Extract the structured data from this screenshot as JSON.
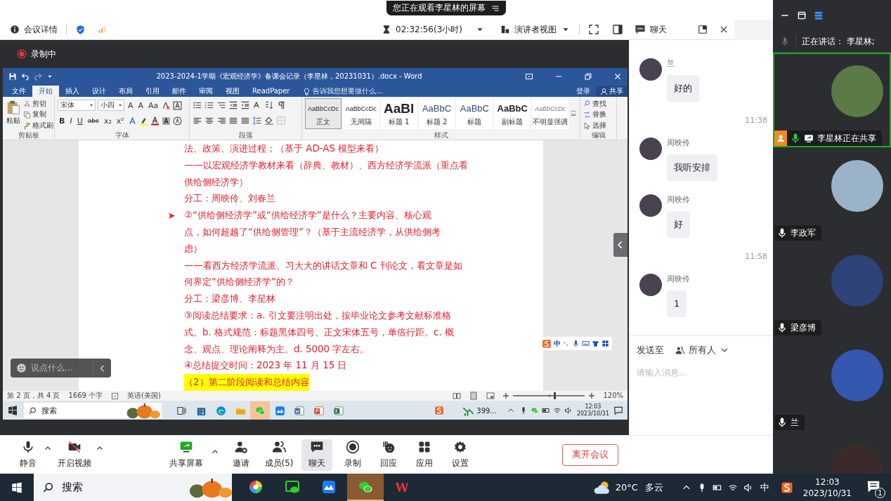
{
  "banner": {
    "text": "您正在观看李星林的屏幕"
  },
  "header": {
    "details": "会议详情",
    "timer": "02:32:56(3小时)",
    "view": "演讲者视图",
    "chat_title": "聊天"
  },
  "recording": {
    "label": "录制中"
  },
  "word": {
    "title": "2023-2024-1学期《宏观经济学》备课会记录（李星林，20231031）.docx - Word",
    "tabs": [
      {
        "label": "文件",
        "selected": false
      },
      {
        "label": "开始",
        "selected": true
      },
      {
        "label": "插入",
        "selected": false
      },
      {
        "label": "设计",
        "selected": false
      },
      {
        "label": "布局",
        "selected": false
      },
      {
        "label": "引用",
        "selected": false
      },
      {
        "label": "邮件",
        "selected": false
      },
      {
        "label": "审阅",
        "selected": false
      },
      {
        "label": "视图",
        "selected": false
      },
      {
        "label": "ReadPaper",
        "selected": false
      }
    ],
    "tell_me": "告诉我您想要做什么...",
    "login": "登录",
    "share": "共享",
    "clipboard": {
      "paste": "粘贴",
      "cut": "剪切",
      "copy": "复制",
      "format_painter": "格式刷",
      "group": "剪贴板"
    },
    "font": {
      "name": "宋体",
      "size": "小四",
      "size_buttons": [
        "A",
        "A",
        "Aa"
      ],
      "format_buttons": [
        "B",
        "I",
        "U",
        "abc",
        "x₂",
        "x²"
      ],
      "group": "字体"
    },
    "paragraph": {
      "group": "段落"
    },
    "styles": {
      "group": "样式",
      "items": [
        {
          "kind": "normal",
          "preview": "AaBbCcDc",
          "label": "正文",
          "selected": true
        },
        {
          "kind": "normal",
          "preview": "AaBbCcDc",
          "label": "无间隔",
          "selected": false
        },
        {
          "kind": "heading1",
          "preview": "AaBl",
          "label": "标题 1",
          "selected": false
        },
        {
          "kind": "heading2",
          "preview": "AaBbC",
          "label": "标题 2",
          "selected": false
        },
        {
          "kind": "heading2",
          "preview": "AaBbC",
          "label": "标题",
          "selected": false
        },
        {
          "kind": "subtitle",
          "preview": "AaBbC",
          "label": "副标题",
          "selected": false
        },
        {
          "kind": "emphasis",
          "preview": "AaBbCcDc",
          "label": "不明显强调",
          "selected": false
        }
      ]
    },
    "editing": {
      "find": "查找",
      "replace": "替换",
      "select": "选择",
      "group": "编辑"
    },
    "document": {
      "lines": [
        {
          "text": "法、政策、演进过程；（基于 AD-AS 模型来看）",
          "bullet": false,
          "highlight": false
        },
        {
          "text": "——以宏观经济学教材来看（辞典、教材）、西方经济学流派（重点看",
          "bullet": false,
          "highlight": false
        },
        {
          "text": "供给侧经济学）",
          "bullet": false,
          "highlight": false
        },
        {
          "text": "分工：周映伶、刘春兰",
          "bullet": false,
          "highlight": false
        },
        {
          "text": "②“供给侧经济学”或“供给经济学”是什么？主要内容、核心观",
          "bullet": true,
          "highlight": false
        },
        {
          "text": "点，如何超越了“供给侧管理”？（基于主流经济学，从供给侧考",
          "bullet": false,
          "highlight": false
        },
        {
          "text": "虑）",
          "bullet": false,
          "highlight": false
        },
        {
          "text": "——看西方经济学流派、习大大的讲话文章和 C 刊论文，看文章是如",
          "bullet": false,
          "highlight": false
        },
        {
          "text": "何界定“供给侧经济学”的？",
          "bullet": false,
          "highlight": false
        },
        {
          "text": "分工：梁彦博、李星林",
          "bullet": false,
          "highlight": false
        },
        {
          "text": "③阅读总结要求：a. 引文要注明出处，按毕业论文参考文献标准格",
          "bullet": false,
          "highlight": false
        },
        {
          "text": "式。b. 格式规范：标题黑体四号、正文宋体五号，单倍行距。c. 概",
          "bullet": false,
          "highlight": false
        },
        {
          "text": "念、观点、理论阐释为主。d. 5000 字左右。",
          "bullet": false,
          "highlight": false
        },
        {
          "text": "④总结提交时间：2023 年 11 月 15 日",
          "bullet": false,
          "highlight": false
        },
        {
          "text": "（2）第二阶段阅读和总结内容",
          "bullet": false,
          "highlight": true
        }
      ]
    },
    "status": {
      "page": "第 2 页，共 4 页",
      "words": "1669 个字",
      "language": "英语(美国)",
      "zoom": "120%"
    }
  },
  "inner_taskbar": {
    "search": "搜索",
    "apps": [
      {
        "kind": "task-view",
        "selected": false
      },
      {
        "kind": "store",
        "selected": false
      },
      {
        "kind": "edge",
        "selected": false
      },
      {
        "kind": "folder",
        "selected": false
      },
      {
        "kind": "wechat",
        "selected": true
      },
      {
        "kind": "lark",
        "selected": false
      },
      {
        "kind": "word",
        "selected": false
      },
      {
        "kind": "ppt",
        "selected": false
      },
      {
        "kind": "excel",
        "selected": false
      }
    ],
    "app_label": "399...",
    "time": "12:03",
    "date": "2023/10/31"
  },
  "overlay": {
    "comment_placeholder": "说点什么...",
    "ime": "中"
  },
  "chat": {
    "items": [
      {
        "kind": "message",
        "sender": "兰",
        "text": "好的"
      },
      {
        "kind": "time",
        "text": "11:38"
      },
      {
        "kind": "message",
        "sender": "周映伶",
        "text": "我听安排"
      },
      {
        "kind": "message",
        "sender": "周映伶",
        "text": "好"
      },
      {
        "kind": "time",
        "text": "11:58"
      },
      {
        "kind": "message",
        "sender": "周映伶",
        "text": "1"
      }
    ],
    "send_to": "发送至",
    "recipient": "所有人",
    "placeholder": "请输入消息..."
  },
  "videos": {
    "speaking": "正在讲话：  李星林;",
    "tiles": [
      {
        "label": "李星林正在共享",
        "highlighted": true,
        "speaking": true,
        "sharing": true
      },
      {
        "label": "李政军",
        "highlighted": false,
        "speaking": false,
        "sharing": false
      },
      {
        "label": "梁彦博",
        "highlighted": false,
        "speaking": false,
        "sharing": false
      },
      {
        "label": "兰",
        "highlighted": false,
        "speaking": false,
        "sharing": false
      },
      {
        "highlighted": false
      }
    ]
  },
  "toolbar": {
    "left": [
      {
        "kind": "mic",
        "label": "静音",
        "menu": true,
        "selected": false
      },
      {
        "kind": "camera-off",
        "label": "开启视频",
        "menu": true,
        "selected": false
      }
    ],
    "center": [
      {
        "kind": "share-screen",
        "label": "共享屏幕",
        "menu": true,
        "selected": false
      },
      {
        "kind": "invite",
        "label": "邀请",
        "menu": false,
        "selected": false
      },
      {
        "kind": "members",
        "label": "成员(5)",
        "menu": false,
        "selected": false
      },
      {
        "kind": "chat",
        "label": "聊天",
        "menu": false,
        "selected": true
      },
      {
        "kind": "record",
        "label": "录制",
        "menu": false,
        "selected": false
      },
      {
        "kind": "reaction",
        "label": "回应",
        "menu": false,
        "selected": false
      },
      {
        "kind": "apps",
        "label": "应用",
        "menu": false,
        "selected": false
      },
      {
        "kind": "settings",
        "label": "设置",
        "menu": false,
        "selected": false
      }
    ],
    "leave": "离开会议"
  },
  "taskbar": {
    "search": "搜索",
    "apps": [
      {
        "kind": "color-wheel",
        "selected": false
      },
      {
        "kind": "screen-chat",
        "selected": false
      },
      {
        "kind": "lark",
        "selected": false
      },
      {
        "kind": "wechat",
        "selected": true
      },
      {
        "kind": "wps",
        "selected": false
      }
    ],
    "temperature": "20°C",
    "weather": "多云",
    "ime": "中",
    "time": "12:03",
    "date": "2023/10/31",
    "notifications": "1"
  }
}
